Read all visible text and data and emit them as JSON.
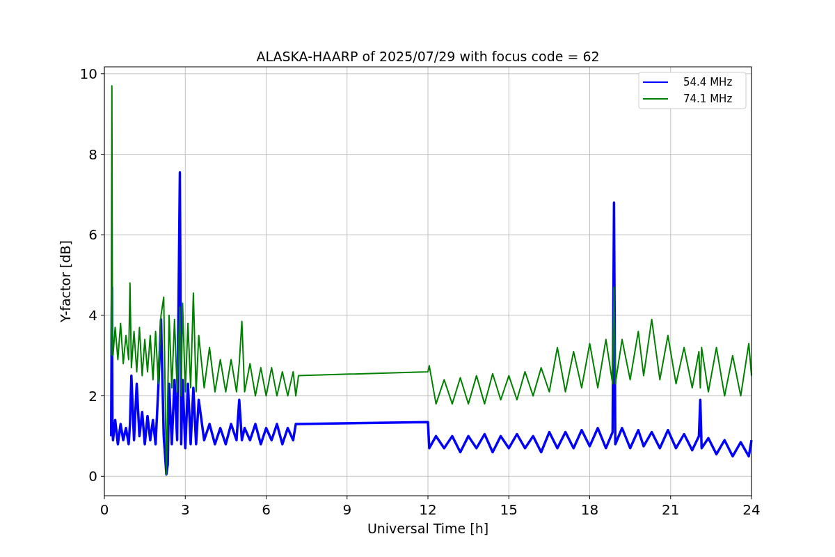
{
  "chart_data": {
    "type": "line",
    "title": "ALASKA-HAARP of 2025/07/29 with focus code = 62",
    "xlabel": "Universal Time [h]",
    "ylabel": "Y-factor [dB]",
    "xlim": [
      0,
      24
    ],
    "ylim": [
      -0.48,
      10.17
    ],
    "xticks": [
      0,
      3,
      6,
      9,
      12,
      15,
      18,
      21,
      24
    ],
    "yticks": [
      0,
      2,
      4,
      6,
      8,
      10
    ],
    "grid": true,
    "legend": true,
    "x": [
      0.25,
      0.28,
      0.3,
      0.32,
      0.4,
      0.5,
      0.6,
      0.7,
      0.8,
      0.9,
      0.95,
      1.0,
      1.1,
      1.2,
      1.3,
      1.4,
      1.5,
      1.6,
      1.7,
      1.8,
      1.9,
      2.0,
      2.1,
      2.2,
      2.3,
      2.35,
      2.4,
      2.5,
      2.6,
      2.7,
      2.8,
      2.85,
      2.9,
      3.0,
      3.1,
      3.2,
      3.3,
      3.4,
      3.5,
      3.7,
      3.9,
      4.1,
      4.3,
      4.5,
      4.7,
      4.9,
      5.0,
      5.1,
      5.2,
      5.4,
      5.6,
      5.8,
      6.0,
      6.2,
      6.4,
      6.6,
      6.8,
      7.0,
      7.1,
      7.2,
      12.0,
      12.05,
      12.3,
      12.6,
      12.9,
      13.2,
      13.5,
      13.8,
      14.1,
      14.4,
      14.7,
      15.0,
      15.3,
      15.6,
      15.9,
      16.2,
      16.5,
      16.8,
      17.1,
      17.4,
      17.7,
      18.0,
      18.3,
      18.6,
      18.85,
      18.9,
      18.95,
      19.2,
      19.5,
      19.8,
      20.0,
      20.3,
      20.6,
      20.9,
      21.2,
      21.5,
      21.8,
      22.05,
      22.1,
      22.15,
      22.4,
      22.7,
      23.0,
      23.3,
      23.6,
      23.9,
      24.0
    ],
    "series": [
      {
        "name": "54.4 MHz",
        "color": "#0000ff",
        "values": [
          1.0,
          4.7,
          1.2,
          0.9,
          1.4,
          0.8,
          1.3,
          0.9,
          1.2,
          0.8,
          1.3,
          2.5,
          0.9,
          2.3,
          1.0,
          1.6,
          0.8,
          1.5,
          0.9,
          1.4,
          0.8,
          2.2,
          3.9,
          1.0,
          0.05,
          0.3,
          2.3,
          0.8,
          2.4,
          0.9,
          7.55,
          0.8,
          2.4,
          0.7,
          2.3,
          0.8,
          2.2,
          0.8,
          1.9,
          0.9,
          1.3,
          0.8,
          1.2,
          0.8,
          1.3,
          0.9,
          1.9,
          0.9,
          1.2,
          0.9,
          1.3,
          0.8,
          1.2,
          0.9,
          1.3,
          0.8,
          1.2,
          0.9,
          1.3,
          1.3,
          1.35,
          0.7,
          1.0,
          0.7,
          1.0,
          0.6,
          1.0,
          0.7,
          1.05,
          0.6,
          1.0,
          0.7,
          1.05,
          0.7,
          1.0,
          0.6,
          1.1,
          0.7,
          1.1,
          0.7,
          1.15,
          0.75,
          1.2,
          0.7,
          1.1,
          6.8,
          0.8,
          1.2,
          0.7,
          1.15,
          0.75,
          1.1,
          0.7,
          1.15,
          0.7,
          1.05,
          0.65,
          1.0,
          1.9,
          0.7,
          0.95,
          0.55,
          0.9,
          0.5,
          0.85,
          0.5,
          0.9
        ]
      },
      {
        "name": "74.1 MHz",
        "color": "#008000",
        "values": [
          3.0,
          9.7,
          3.6,
          3.0,
          3.7,
          2.9,
          3.8,
          2.8,
          3.5,
          2.9,
          4.8,
          2.7,
          3.6,
          2.6,
          3.7,
          2.5,
          3.4,
          2.6,
          3.5,
          2.4,
          3.6,
          2.3,
          4.0,
          4.45,
          0.05,
          2.0,
          4.0,
          2.2,
          3.9,
          2.1,
          4.2,
          2.0,
          4.3,
          2.1,
          3.8,
          2.2,
          4.55,
          2.1,
          3.5,
          2.2,
          3.2,
          2.1,
          2.9,
          2.1,
          2.9,
          2.1,
          2.8,
          3.85,
          2.1,
          2.8,
          2.0,
          2.7,
          2.0,
          2.7,
          2.0,
          2.6,
          2.0,
          2.6,
          2.0,
          2.5,
          2.6,
          2.75,
          1.8,
          2.4,
          1.8,
          2.45,
          1.8,
          2.5,
          1.8,
          2.55,
          1.9,
          2.5,
          1.9,
          2.6,
          2.0,
          2.7,
          2.1,
          3.2,
          2.1,
          3.1,
          2.2,
          3.3,
          2.2,
          3.4,
          2.3,
          4.7,
          2.3,
          3.4,
          2.4,
          3.6,
          2.5,
          3.9,
          2.4,
          3.5,
          2.3,
          3.2,
          2.2,
          3.1,
          2.2,
          3.2,
          2.1,
          3.2,
          2.0,
          3.0,
          2.0,
          3.3,
          2.5
        ]
      }
    ]
  }
}
